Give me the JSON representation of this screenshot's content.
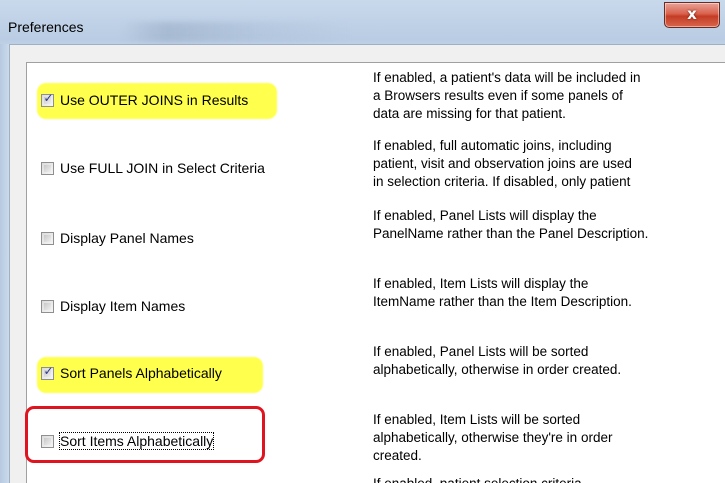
{
  "window": {
    "title": "Preferences",
    "close_glyph": "x"
  },
  "options": [
    {
      "label": "Use OUTER JOINS in Results",
      "checked": true,
      "highlight": true,
      "desc": [
        "If enabled, a patient's data will be included in",
        "a Browsers results even if some panels of",
        "data are missing for that patient."
      ]
    },
    {
      "label": "Use FULL JOIN in Select Criteria",
      "checked": false,
      "highlight": false,
      "desc": [
        "If enabled, full automatic joins, including",
        "patient, visit and observation joins are used",
        "in selection criteria.  If disabled, only patient"
      ]
    },
    {
      "label": "Display Panel Names",
      "checked": false,
      "highlight": false,
      "desc": [
        "If enabled, Panel Lists will display the",
        "PanelName rather than the Panel Description."
      ]
    },
    {
      "label": "Display Item Names",
      "checked": false,
      "highlight": false,
      "desc": [
        "If enabled, Item Lists will display the",
        "ItemName rather than the Item Description."
      ]
    },
    {
      "label": "Sort Panels Alphabetically",
      "checked": true,
      "highlight": true,
      "desc": [
        "If enabled, Panel Lists will be sorted",
        "alphabetically, otherwise in order created."
      ]
    },
    {
      "label": "Sort Items Alphabetically",
      "checked": false,
      "highlight": false,
      "desc": [
        "If enabled, Item Lists will be sorted",
        "alphabetically, otherwise they're in order",
        "created."
      ]
    },
    {
      "label": "",
      "checked": false,
      "highlight": false,
      "desc": [
        "If enabled, patient selection criteria"
      ]
    }
  ],
  "colors": {
    "highlight": "#ffff4d",
    "annotation_box": "#e0141f",
    "close_button": "#c43c25"
  }
}
